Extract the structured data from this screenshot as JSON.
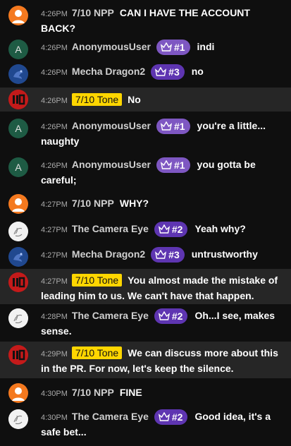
{
  "messages": [
    {
      "time": "4:26PM",
      "author": "7/10 NPP",
      "text": "CAN I HAVE THE ACCOUNT BACK?"
    },
    {
      "time": "4:26PM",
      "author": "AnonymousUser",
      "badge": "#1",
      "text": "indi"
    },
    {
      "time": "4:26PM",
      "author": "Mecha Dragon2",
      "badge": "#3",
      "text": "no"
    },
    {
      "time": "4:26PM",
      "author": "7/10 Tone",
      "text": "No"
    },
    {
      "time": "4:26PM",
      "author": "AnonymousUser",
      "badge": "#1",
      "text": "you're a little... naughty"
    },
    {
      "time": "4:26PM",
      "author": "AnonymousUser",
      "badge": "#1",
      "text": "you gotta be careful;"
    },
    {
      "time": "4:27PM",
      "author": "7/10 NPP",
      "text": "WHY?"
    },
    {
      "time": "4:27PM",
      "author": "The Camera Eye",
      "badge": "#2",
      "text": "Yeah why?"
    },
    {
      "time": "4:27PM",
      "author": "Mecha Dragon2",
      "badge": "#3",
      "text": "untrustworthy"
    },
    {
      "time": "4:27PM",
      "author": "7/10 Tone",
      "text": "You almost made the mistake of leading him to us. We can't have that happen."
    },
    {
      "time": "4:28PM",
      "author": "The Camera Eye",
      "badge": "#2",
      "text": "Oh...I see, makes sense."
    },
    {
      "time": "4:29PM",
      "author": "7/10 Tone",
      "text": "We can discuss more about this in the PR. For now, let's keep the silence."
    },
    {
      "time": "4:30PM",
      "author": "7/10 NPP",
      "text": "FINE"
    },
    {
      "time": "4:30PM",
      "author": "The Camera Eye",
      "badge": "#2",
      "text": "Good idea, it's a safe bet..."
    }
  ],
  "colors": {
    "background": "#0f0f0f",
    "highlight_row": "#262626",
    "author_tag": "#ffd600",
    "badge": "#5e35b1",
    "badge_pale": "#7e57c2",
    "npp_avatar": "#f4791f",
    "anon_avatar": "#1e5b44",
    "dragon_avatar": "#1a3a7a",
    "tone_avatar": "#c41a1a"
  },
  "icons": {
    "badge": "crown-icon",
    "npp": "person-icon",
    "anonymous": "letter-avatar",
    "camera_eye": "sketch-avatar",
    "dragon": "dragon-avatar",
    "tone": "logo-avatar"
  },
  "anon_initial": "A"
}
